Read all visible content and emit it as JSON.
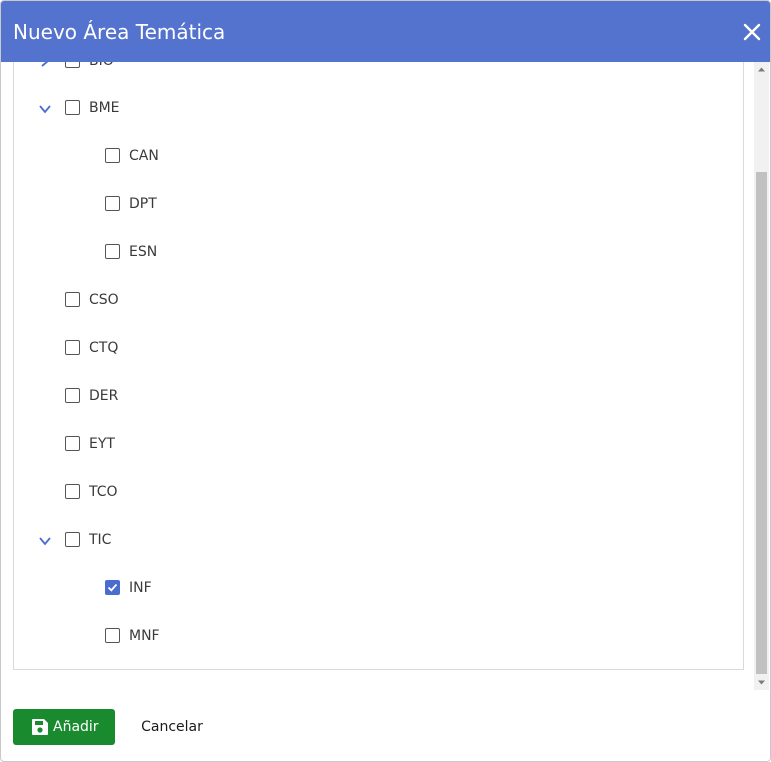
{
  "dialog": {
    "title": "Nuevo Área Temática",
    "header_color": "#5473cf"
  },
  "tree": {
    "items": [
      {
        "label": "BIO",
        "expanded": false,
        "checked": false,
        "level": 0,
        "has_children": true
      },
      {
        "label": "BME",
        "expanded": true,
        "checked": false,
        "level": 0,
        "has_children": true
      },
      {
        "label": "CAN",
        "checked": false,
        "level": 1
      },
      {
        "label": "DPT",
        "checked": false,
        "level": 1
      },
      {
        "label": "ESN",
        "checked": false,
        "level": 1
      },
      {
        "label": "CSO",
        "checked": false,
        "level": 0
      },
      {
        "label": "CTQ",
        "checked": false,
        "level": 0
      },
      {
        "label": "DER",
        "checked": false,
        "level": 0
      },
      {
        "label": "EYT",
        "checked": false,
        "level": 0
      },
      {
        "label": "TCO",
        "checked": false,
        "level": 0
      },
      {
        "label": "TIC",
        "expanded": true,
        "checked": false,
        "level": 0,
        "has_children": true
      },
      {
        "label": "INF",
        "checked": true,
        "level": 1
      },
      {
        "label": "MNF",
        "checked": false,
        "level": 1
      }
    ]
  },
  "footer": {
    "add_label": "Añadir",
    "cancel_label": "Cancelar",
    "add_color": "#1a8a2e"
  },
  "icons": {
    "close": "close-icon",
    "save": "save-icon",
    "expand": "chevron-down-icon",
    "collapsed": "chevron-right-icon",
    "checkmark": "check-icon"
  }
}
